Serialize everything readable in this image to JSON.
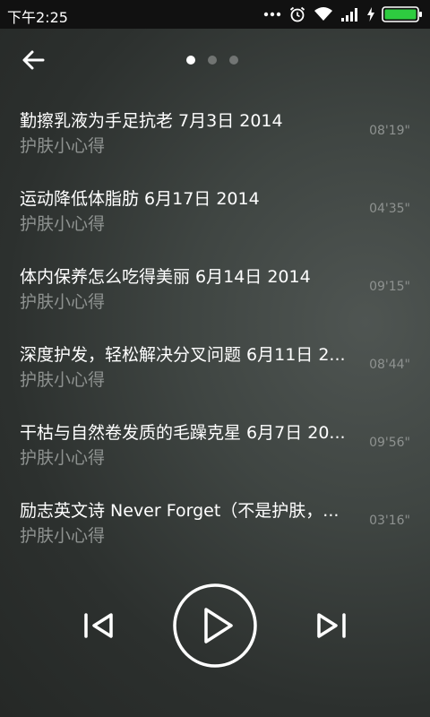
{
  "status_bar": {
    "time": "下午2:25"
  },
  "header": {
    "page_indicator": {
      "pages": 3,
      "active": 1
    }
  },
  "playlist": [
    {
      "title": "勤擦乳液为手足抗老 7月3日 2014",
      "source": "护肤小心得",
      "duration": "08'19\""
    },
    {
      "title": "运动降低体脂肪 6月17日 2014",
      "source": "护肤小心得",
      "duration": "04'35\""
    },
    {
      "title": "体内保养怎么吃得美丽 6月14日 2014",
      "source": "护肤小心得",
      "duration": "09'15\""
    },
    {
      "title": "深度护发，轻松解决分叉问题 6月11日 2...",
      "source": "护肤小心得",
      "duration": "08'44\""
    },
    {
      "title": "干枯与自然卷发质的毛躁克星 6月7日 20...",
      "source": "护肤小心得",
      "duration": "09'56\""
    },
    {
      "title": "励志英文诗 Never Forget（不是护肤，...",
      "source": "护肤小心得",
      "duration": "03'16\""
    }
  ],
  "colors": {
    "battery": "#2ecc40",
    "secondary_text": "#8e9290"
  },
  "icons": {
    "back": "arrow-left-icon",
    "prev": "skip-previous-icon",
    "play": "play-icon",
    "next": "skip-next-icon"
  }
}
